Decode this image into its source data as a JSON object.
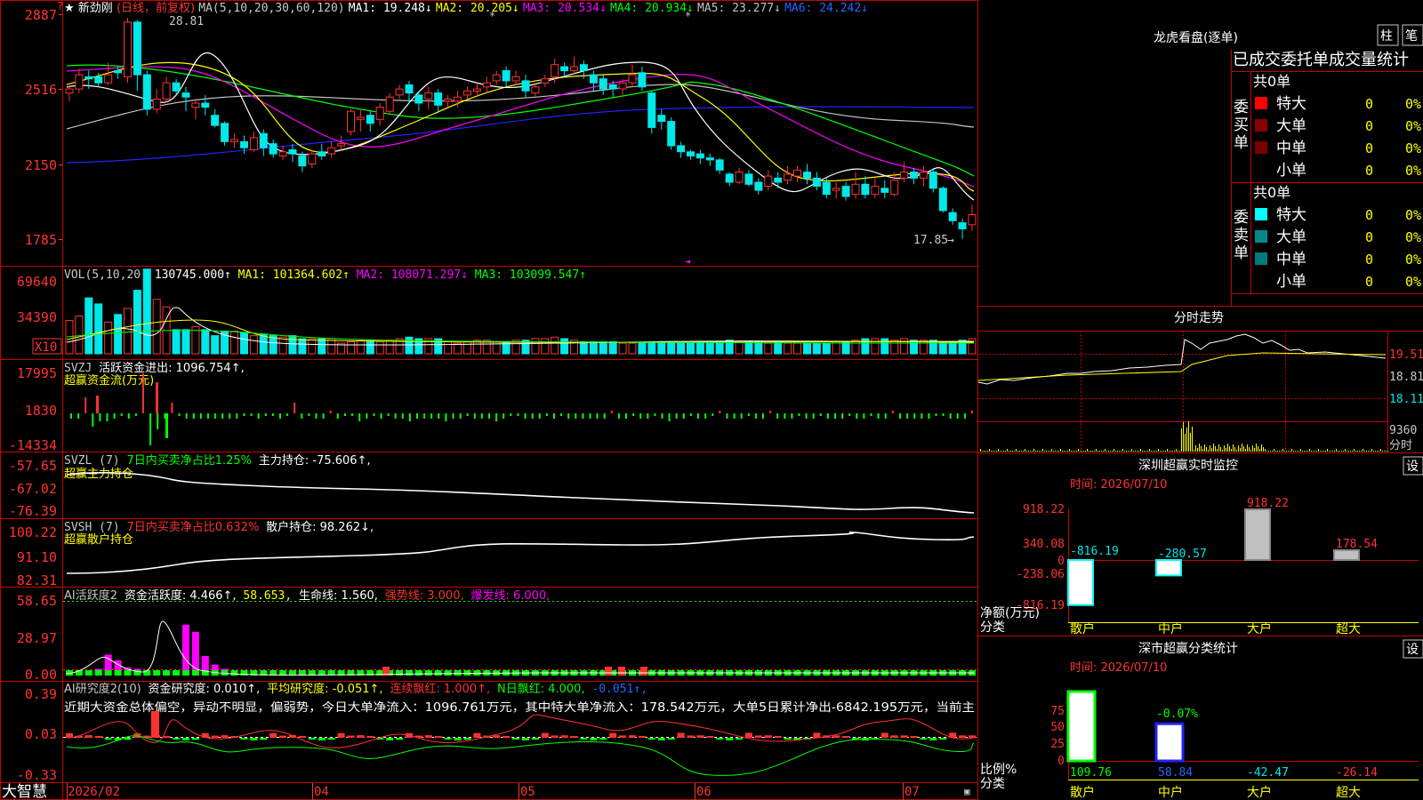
{
  "colors": {
    "up": "#ff3232",
    "down": "#00e8e8",
    "vol_up": "#ff3232",
    "vol_down": "#00e8e8",
    "grid": "#b00000",
    "text": "#c8c8c8",
    "accent_yellow": "#ffff00",
    "ma1": "#ffffff",
    "ma2": "#ffff00",
    "ma3": "#ff00ff",
    "ma4": "#00ff00",
    "ma5": "#c0c0c0",
    "ma6": "#2222ff",
    "green": "#00ff00",
    "magenta": "#ff00ff"
  },
  "header": {
    "star": "★",
    "stock_name": "新劲刚",
    "period": "(日线，前复权)",
    "ma_label": "MA(5,10,20,30,60,120)",
    "ma1": "MA1: 19.248↓",
    "ma2": "MA2: 20.205↓",
    "ma3": "MA3: 20.534↓",
    "ma4": "MA4: 20.934↓",
    "ma5": "MA5: 23.277↓",
    "ma6": "MA6: 24.242↓"
  },
  "price_axis": [
    "2887",
    "2516",
    "2150",
    "1785"
  ],
  "price_annotations": {
    "high": "28.81",
    "low": "17.85"
  },
  "vol": {
    "label": "VOL(5,10,20)",
    "value": "130745.000↑",
    "ma1": "MA1: 101364.602↑",
    "ma2": "MA2: 108071.297↓",
    "ma3": "MA3: 103099.547↑",
    "axis": [
      "69640",
      "34390"
    ],
    "unit": "X10"
  },
  "svzj": {
    "label": "SVZJ",
    "desc": "活跃资金进出: 1096.754↑,",
    "subtitle": "超赢资金流(万元)",
    "axis": [
      "17995",
      "1830",
      "-14334"
    ]
  },
  "svzl": {
    "label": "SVZL (7)",
    "desc": "7日内买卖净占比1.25%",
    "value": "主力持仓: -75.606↑,",
    "subtitle": "超赢主力持仓",
    "axis": [
      "-57.65",
      "-67.02",
      "-76.39"
    ]
  },
  "svsh": {
    "label": "SVSH (7)",
    "desc": "7日内买卖净占比0.632%",
    "value": "散户持仓: 98.262↓,",
    "subtitle": "超赢散户持仓",
    "axis": [
      "100.22",
      "91.10",
      "82.31"
    ]
  },
  "ai1": {
    "label": "AI活跃度2",
    "v1": "资金活跃度: 4.466↑,",
    "v2": "58.653,",
    "v3": "生命线: 1.560,",
    "v4": "强势线: 3.000,",
    "v5": "爆发线: 6.000,",
    "axis": [
      "58.65",
      "28.97",
      "0.00"
    ]
  },
  "ai2": {
    "label": "AI研究度2(10)",
    "v1": "资金研究度: 0.010↑,",
    "v2": "平均研究度: -0.051↑,",
    "v3": "连续飘红: 1.000↑,",
    "v4": "N日飘红: 4.000,",
    "v5": "-0.051↑,",
    "comment": "近期大资金总体偏空，异动不明显，偏弱势，今日大单净流入：1096.761万元，其中特大单净流入：178.542万元，大单5日累计净出-6842.195万元，当前主",
    "axis": [
      "0.39",
      "0.03",
      "-0.33"
    ]
  },
  "footer": {
    "brand": "大智慧",
    "dates": [
      "2026/02",
      "04",
      "05",
      "06",
      "07"
    ]
  },
  "longhu": {
    "title": "龙虎看盘(逐单)",
    "btn1": "柱",
    "btn2": "笔",
    "subtitle": "已成交委托单成交量统计",
    "buy_label": "委买单",
    "sell_label": "委卖单",
    "buy_total": "共0单",
    "sell_total": "共0单",
    "buy_rows": [
      {
        "name": "特大",
        "n": "0",
        "p": "0%"
      },
      {
        "name": "大单",
        "n": "0",
        "p": "0%"
      },
      {
        "name": "中单",
        "n": "0",
        "p": "0%"
      },
      {
        "name": "小单",
        "n": "0",
        "p": "0%"
      }
    ],
    "sell_rows": [
      {
        "name": "特大",
        "n": "0",
        "p": "0%"
      },
      {
        "name": "大单",
        "n": "0",
        "p": "0%"
      },
      {
        "name": "中单",
        "n": "0",
        "p": "0%"
      },
      {
        "name": "小单",
        "n": "0",
        "p": "0%"
      }
    ]
  },
  "intraday": {
    "title": "分时走势",
    "axis": [
      "19.51",
      "18.81",
      "18.11"
    ],
    "vol_axis": "9360",
    "vol_label": "分时"
  },
  "monitor": {
    "title": "深圳超赢实时监控",
    "btn": "设",
    "time": "时间: 2026/07/10",
    "axis": [
      "918.22",
      "340.08",
      "0",
      "-238.06",
      "-816.19"
    ],
    "ylabel": "净额(万元)",
    "xlabel": "分类",
    "bars": [
      {
        "cat": "散户",
        "value": -816.19,
        "label": "-816.19"
      },
      {
        "cat": "中户",
        "value": -280.57,
        "label": "-280.57"
      },
      {
        "cat": "大户",
        "value": 918.22,
        "label": "918.22"
      },
      {
        "cat": "超大",
        "value": 178.54,
        "label": "178.54"
      }
    ]
  },
  "stats": {
    "title": "深市超赢分类统计",
    "btn": "设",
    "time": "时间: 2026/07/10",
    "axis": [
      "75",
      "50",
      "25",
      "0"
    ],
    "ylabel": "比例%",
    "xlabel": "分类",
    "top_label": "-0.07%",
    "bars": [
      {
        "cat": "散户",
        "value": 109.76,
        "label": "109.76"
      },
      {
        "cat": "中户",
        "value": 58.84,
        "label": "58.84"
      },
      {
        "cat": "大户",
        "value": -42.47,
        "label": "-42.47"
      },
      {
        "cat": "超大",
        "value": -26.14,
        "label": "-26.14"
      }
    ]
  },
  "chart_data": {
    "type": "candlestick",
    "price_range": [
      17.85,
      28.81
    ],
    "candles": [
      [
        25.1,
        25.3,
        24.7,
        25.6
      ],
      [
        25.3,
        26.0,
        25.1,
        26.3
      ],
      [
        25.9,
        25.8,
        25.3,
        26.2
      ],
      [
        25.9,
        25.6,
        25.4,
        26.1
      ],
      [
        25.6,
        26.0,
        25.5,
        26.6
      ],
      [
        26.2,
        26.1,
        25.8,
        26.4
      ],
      [
        25.9,
        28.6,
        25.6,
        28.8
      ],
      [
        28.6,
        26.0,
        25.2,
        28.7
      ],
      [
        26.0,
        24.3,
        24.0,
        26.2
      ],
      [
        24.3,
        24.8,
        24.1,
        25.3
      ],
      [
        24.8,
        25.6,
        24.6,
        25.9
      ],
      [
        25.6,
        25.2,
        25.0,
        25.8
      ],
      [
        25.1,
        24.9,
        24.2,
        25.4
      ],
      [
        24.4,
        24.6,
        23.8,
        24.8
      ],
      [
        24.6,
        24.4,
        24.0,
        25.0
      ],
      [
        24.0,
        23.5,
        23.4,
        24.3
      ],
      [
        23.6,
        22.7,
        22.5,
        23.7
      ],
      [
        22.7,
        22.8,
        22.4,
        23.1
      ],
      [
        22.7,
        22.4,
        22.1,
        23.0
      ],
      [
        22.3,
        22.9,
        22.2,
        23.2
      ],
      [
        23.1,
        22.4,
        22.0,
        23.3
      ],
      [
        22.6,
        22.1,
        21.9,
        22.8
      ],
      [
        22.0,
        22.2,
        21.8,
        22.5
      ],
      [
        22.3,
        22.1,
        21.7,
        22.6
      ],
      [
        22.0,
        21.5,
        21.2,
        22.2
      ],
      [
        21.6,
        22.1,
        21.4,
        22.3
      ],
      [
        22.2,
        22.0,
        21.8,
        22.6
      ],
      [
        22.1,
        22.4,
        21.9,
        22.7
      ],
      [
        22.5,
        22.6,
        22.3,
        23.0
      ],
      [
        23.2,
        24.2,
        23.0,
        24.3
      ],
      [
        23.8,
        23.9,
        23.2,
        24.3
      ],
      [
        24.0,
        23.6,
        23.2,
        24.2
      ],
      [
        23.8,
        24.4,
        23.5,
        24.6
      ],
      [
        24.2,
        24.9,
        24.0,
        25.1
      ],
      [
        25.0,
        25.3,
        24.8,
        25.5
      ],
      [
        25.5,
        25.1,
        24.6,
        25.7
      ],
      [
        25.0,
        24.6,
        24.2,
        25.2
      ],
      [
        24.8,
        25.1,
        24.3,
        25.4
      ],
      [
        25.1,
        24.5,
        24.1,
        25.3
      ],
      [
        24.7,
        24.8,
        24.4,
        25.0
      ],
      [
        24.7,
        24.9,
        24.4,
        25.2
      ],
      [
        25.0,
        25.2,
        24.8,
        25.4
      ],
      [
        25.2,
        25.3,
        24.9,
        25.6
      ],
      [
        25.4,
        25.6,
        25.1,
        25.9
      ],
      [
        25.7,
        26.0,
        25.5,
        26.2
      ],
      [
        26.2,
        25.7,
        25.4,
        26.4
      ],
      [
        25.7,
        25.9,
        25.5,
        26.2
      ],
      [
        25.7,
        25.2,
        24.9,
        26.0
      ],
      [
        25.1,
        25.4,
        24.9,
        25.6
      ],
      [
        25.6,
        25.8,
        25.4,
        26.0
      ],
      [
        25.9,
        26.5,
        25.6,
        26.8
      ],
      [
        26.4,
        26.2,
        25.9,
        26.6
      ],
      [
        26.2,
        26.4,
        26.0,
        26.9
      ],
      [
        26.5,
        26.2,
        25.8,
        26.7
      ],
      [
        26.0,
        25.6,
        25.2,
        26.2
      ],
      [
        25.8,
        25.3,
        25.0,
        26.0
      ],
      [
        25.5,
        25.3,
        24.9,
        25.7
      ],
      [
        25.3,
        25.6,
        25.0,
        25.8
      ],
      [
        25.6,
        26.0,
        25.4,
        26.5
      ],
      [
        26.1,
        25.4,
        25.2,
        26.4
      ],
      [
        25.1,
        23.4,
        23.1,
        25.2
      ],
      [
        24.0,
        23.7,
        23.3,
        24.3
      ],
      [
        23.7,
        22.5,
        22.3,
        23.9
      ],
      [
        22.5,
        22.2,
        21.9,
        22.7
      ],
      [
        22.2,
        22.0,
        21.8,
        22.3
      ],
      [
        22.1,
        21.9,
        21.6,
        22.3
      ],
      [
        21.9,
        21.8,
        21.5,
        22.1
      ],
      [
        21.8,
        21.3,
        21.1,
        21.9
      ],
      [
        21.1,
        20.7,
        20.5,
        21.2
      ],
      [
        20.7,
        21.2,
        20.6,
        21.4
      ],
      [
        21.1,
        20.6,
        20.5,
        21.3
      ],
      [
        20.7,
        20.3,
        20.1,
        20.9
      ],
      [
        20.5,
        21.0,
        20.3,
        21.3
      ],
      [
        20.9,
        20.7,
        20.4,
        21.2
      ],
      [
        20.8,
        21.1,
        20.6,
        21.5
      ],
      [
        21.0,
        21.3,
        20.7,
        21.5
      ],
      [
        21.2,
        20.9,
        20.6,
        21.6
      ],
      [
        20.9,
        20.5,
        20.3,
        21.2
      ],
      [
        20.7,
        20.1,
        19.9,
        20.9
      ],
      [
        20.3,
        20.4,
        19.9,
        20.7
      ],
      [
        20.5,
        20.0,
        19.8,
        20.7
      ],
      [
        20.1,
        20.6,
        19.9,
        21.2
      ],
      [
        20.6,
        20.1,
        19.9,
        21.0
      ],
      [
        20.1,
        20.5,
        19.9,
        20.9
      ],
      [
        20.4,
        20.2,
        19.9,
        20.8
      ],
      [
        20.1,
        20.8,
        20.0,
        21.2
      ],
      [
        20.9,
        21.2,
        20.7,
        21.7
      ],
      [
        21.2,
        20.9,
        20.6,
        21.4
      ],
      [
        20.9,
        21.2,
        20.5,
        21.5
      ],
      [
        21.2,
        20.4,
        20.2,
        21.4
      ],
      [
        20.4,
        19.3,
        19.2,
        20.5
      ],
      [
        19.2,
        18.8,
        18.6,
        19.4
      ],
      [
        18.7,
        18.4,
        17.9,
        18.9
      ],
      [
        18.6,
        19.1,
        18.3,
        19.6
      ]
    ],
    "volume": [
      2.2,
      2.5,
      3.7,
      3.3,
      2.1,
      2.6,
      3.0,
      4.2,
      5.6,
      3.6,
      3.1,
      1.6,
      1.6,
      1.8,
      1.6,
      1.2,
      1.5,
      1.5,
      1.4,
      1.2,
      1.3,
      1.2,
      1.1,
      1.2,
      1.0,
      1.0,
      1.0,
      1.0,
      0.7,
      0.8,
      0.9,
      0.9,
      0.8,
      0.9,
      1.0,
      1.1,
      1.0,
      1.0,
      1.0,
      0.8,
      0.7,
      0.8,
      0.9,
      0.9,
      0.8,
      0.8,
      0.9,
      0.9,
      1.0,
      1.0,
      1.1,
      1.0,
      0.9,
      0.8,
      0.8,
      0.8,
      0.8,
      0.7,
      0.7,
      0.7,
      0.7,
      0.8,
      0.8,
      0.8,
      0.7,
      0.8,
      0.8,
      0.8,
      0.9,
      0.8,
      0.8,
      0.8,
      0.7,
      0.8,
      0.7,
      0.7,
      0.7,
      0.7,
      0.7,
      0.8,
      0.8,
      0.9,
      1.0,
      1.0,
      1.0,
      0.9,
      1.0,
      0.9,
      0.9,
      0.9,
      0.8,
      0.8,
      0.9,
      1.0
    ],
    "vol_ma": [
      2.7,
      2.9,
      2.9,
      3.0,
      2.9,
      2.8,
      2.9,
      3.2,
      3.6,
      3.7,
      3.6,
      3.3,
      3.1,
      2.7,
      2.3,
      1.9,
      1.8,
      1.6,
      1.5,
      1.4,
      1.4,
      1.3,
      1.2,
      1.2,
      1.2,
      1.1,
      1.1,
      1.0,
      1.0,
      1.0,
      1.0,
      0.9,
      0.9,
      0.9,
      0.9,
      0.9,
      1.0,
      1.0,
      1.0,
      1.0,
      0.9,
      0.9,
      0.9,
      0.9,
      0.8,
      0.8,
      0.9,
      0.9,
      0.9,
      0.9,
      1.0,
      1.0,
      1.0,
      0.9,
      0.9,
      0.9,
      0.8,
      0.8,
      0.8,
      0.8,
      0.8,
      0.8,
      0.8,
      0.8,
      0.8,
      0.8,
      0.8,
      0.8,
      0.8,
      0.8,
      0.8,
      0.8,
      0.8,
      0.8,
      0.8,
      0.8,
      0.7,
      0.7,
      0.7,
      0.7,
      0.8,
      0.8,
      0.9,
      0.9,
      0.9,
      0.9,
      0.9,
      0.9,
      0.9,
      0.9,
      0.9,
      0.9,
      0.9,
      0.9
    ],
    "flow": [
      0,
      3,
      0,
      12,
      0,
      3,
      0,
      0,
      -3,
      0,
      -5,
      0,
      0,
      0,
      0,
      -4,
      0,
      0,
      0,
      -3,
      0,
      -2,
      0,
      0,
      0,
      0,
      0,
      -3,
      0,
      0,
      0,
      0,
      0,
      0,
      0,
      0,
      0,
      0,
      0,
      0,
      0,
      0,
      0,
      0,
      0,
      0,
      0,
      0,
      0,
      0,
      0,
      0,
      0,
      0,
      0,
      0,
      0,
      0,
      0,
      0,
      0,
      0,
      0,
      0,
      0,
      0,
      0,
      0,
      0,
      0,
      0,
      0,
      0,
      0,
      0,
      0,
      0,
      0,
      0,
      0,
      0,
      0,
      0,
      0,
      0,
      0,
      0,
      0,
      0,
      0,
      0,
      0,
      0,
      0
    ],
    "flow_bars": [
      -2,
      -2,
      6,
      -5,
      -3,
      -3,
      -2,
      -1,
      -2,
      -1,
      15,
      -12,
      -6,
      -2,
      4,
      -1,
      -2,
      -2,
      -2,
      -2,
      -2,
      -2,
      -2,
      -2,
      -1,
      -1,
      -2,
      -1,
      -1,
      -2,
      -1,
      4,
      -2,
      -1,
      -2,
      -2,
      1,
      -2,
      -1,
      -1,
      -3,
      -2,
      -1,
      -2,
      -1,
      -2,
      -2,
      -3,
      -2,
      -2,
      -2,
      -2,
      -3,
      -2,
      -2,
      -1,
      -2,
      -2,
      -2,
      -3,
      -2,
      -1,
      -1,
      -2,
      -2,
      -2,
      -1,
      -2,
      -1,
      -2,
      -2,
      -2,
      -2,
      -2,
      -2,
      1,
      -2,
      -2,
      -1,
      -2,
      -2,
      -1,
      -2,
      -3,
      -2,
      -2,
      -1,
      -2,
      -2,
      -1,
      1,
      -2,
      -2,
      -2,
      -1,
      -2,
      -2,
      1,
      -2,
      -2,
      -2,
      -1,
      -2,
      -2,
      -1,
      -2,
      -2,
      -2,
      -1,
      -2,
      -2,
      -1,
      -2,
      -2,
      1,
      -2,
      -2,
      -2,
      -2,
      -2,
      -1,
      -1,
      -2,
      -2,
      -2,
      1
    ],
    "ai_act": [
      0,
      0,
      0,
      1,
      11,
      7,
      2,
      1,
      0,
      0,
      0,
      0,
      32,
      27,
      10,
      4,
      1,
      0,
      0,
      0,
      0,
      0,
      0,
      0,
      0,
      0,
      0,
      0,
      0,
      0,
      0,
      0,
      0,
      0,
      0,
      0,
      0,
      0,
      0,
      0,
      0,
      0,
      0,
      0,
      0,
      0,
      0,
      0,
      0,
      0,
      0,
      0,
      0,
      0,
      0,
      0,
      0,
      0,
      0,
      0,
      0,
      0,
      0,
      0,
      0,
      0,
      0,
      0,
      0,
      0,
      0,
      0,
      0,
      0,
      0,
      0,
      0,
      0,
      0,
      0,
      0,
      0,
      0,
      0,
      0,
      0,
      0,
      0,
      0,
      0,
      0,
      0,
      0,
      0,
      0,
      0
    ]
  }
}
